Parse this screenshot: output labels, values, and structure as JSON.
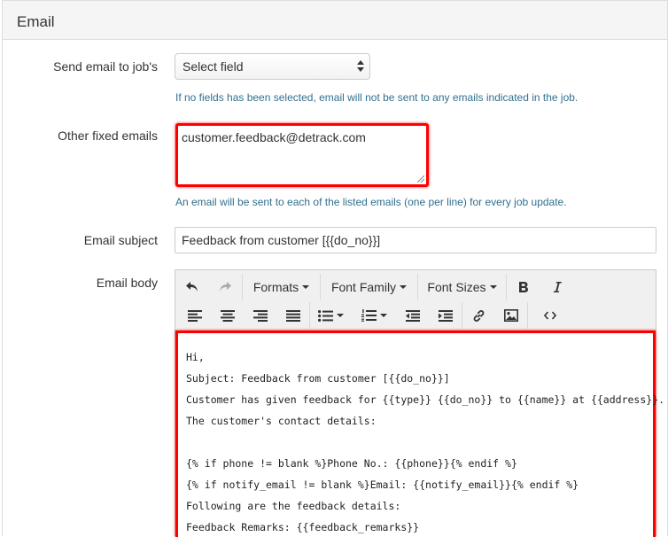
{
  "panel": {
    "title": "Email"
  },
  "send_email_to": {
    "label": "Send email to job's",
    "selected": "Select field",
    "help": "If no fields has been selected, email will not be sent to any emails indicated in the job."
  },
  "other_fixed_emails": {
    "label": "Other fixed emails",
    "value": "customer.feedback@detrack.com",
    "help": "An email will be sent to each of the listed emails (one per line) for every job update."
  },
  "email_subject": {
    "label": "Email subject",
    "value": "Feedback from customer [{{do_no}}]"
  },
  "email_body": {
    "label": "Email body",
    "toolbar": {
      "formats": "Formats",
      "font_family": "Font Family",
      "font_sizes": "Font Sizes",
      "icons": [
        "undo-icon",
        "redo-icon",
        "bold-icon",
        "italic-icon",
        "align-left-icon",
        "align-center-icon",
        "align-right-icon",
        "align-justify-icon",
        "bullet-list-icon",
        "numbered-list-icon",
        "outdent-icon",
        "indent-icon",
        "link-icon",
        "image-icon",
        "code-icon"
      ]
    },
    "lines": [
      "Hi,",
      "Subject: Feedback from customer [{{do_no}}]",
      "Customer has given feedback for {{type}} {{do_no}} to {{name}} at {{address}}.",
      "The customer's contact details:",
      "",
      "{% if phone != blank %}Phone No.: {{phone}}{% endif %}",
      "{% if notify_email != blank %}Email: {{notify_email}}{% endif %}",
      "Following are the feedback details:",
      "Feedback Remarks: {{feedback_remarks}}"
    ]
  },
  "colors": {
    "highlight": "#ff0000",
    "help_text": "#31708f",
    "heading_bg": "#f5f5f5"
  }
}
